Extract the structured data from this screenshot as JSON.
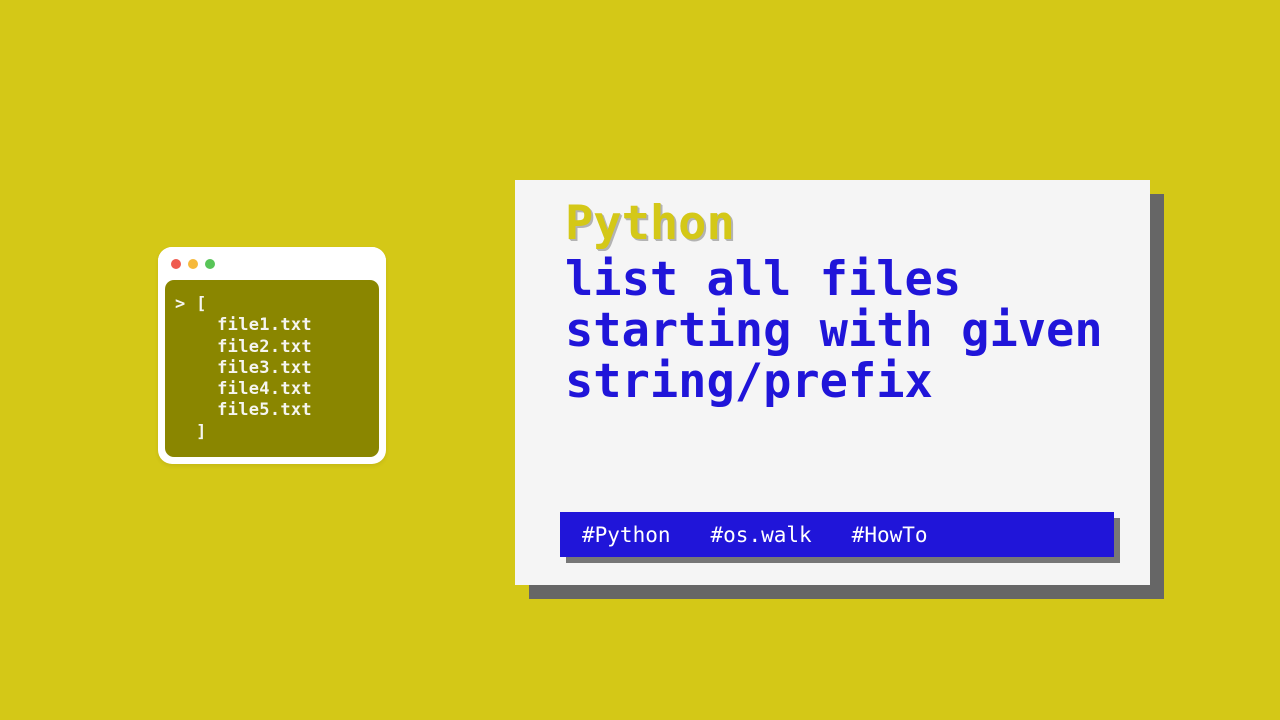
{
  "terminal": {
    "dots": {
      "red": "#ef5b50",
      "yellow": "#f6b93b",
      "green": "#58c558"
    },
    "content": "> [\n    file1.txt\n    file2.txt\n    file3.txt\n    file4.txt\n    file5.txt\n  ]"
  },
  "card": {
    "title1": "Python",
    "title2": "list all files starting with given string/prefix"
  },
  "tags": {
    "tag1": "#Python",
    "tag2": "#os.walk",
    "tag3": "#HowTo"
  },
  "colors": {
    "bg": "#d4c817",
    "blue": "#2015d9",
    "olive": "#8a8600"
  }
}
